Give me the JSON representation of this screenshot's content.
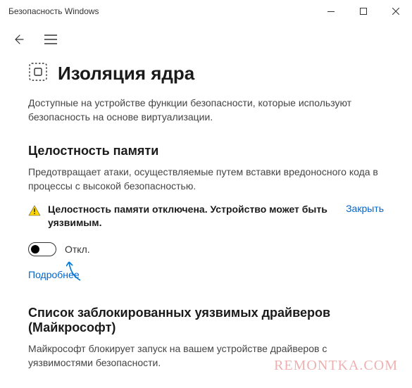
{
  "window": {
    "title": "Безопасность Windows"
  },
  "page": {
    "title": "Изоляция ядра",
    "intro": "Доступные на устройстве функции безопасности, которые используют безопасность на основе виртуализации."
  },
  "memory_integrity": {
    "title": "Целостность памяти",
    "desc": "Предотвращает атаки, осуществляемые путем вставки вредоносного кода в процессы с высокой безопасностью.",
    "alert_text": "Целостность памяти отключена. Устройство может быть уязвимым.",
    "alert_action": "Закрыть",
    "toggle_label": "Откл.",
    "learn_more": "Подробнее"
  },
  "blocklist": {
    "title": "Список заблокированных уязвимых драйверов (Майкрософт)",
    "desc": "Майкрософт блокирует запуск на вашем устройстве драйверов с уязвимостями безопасности."
  },
  "watermark": "REMONTKA.COM"
}
